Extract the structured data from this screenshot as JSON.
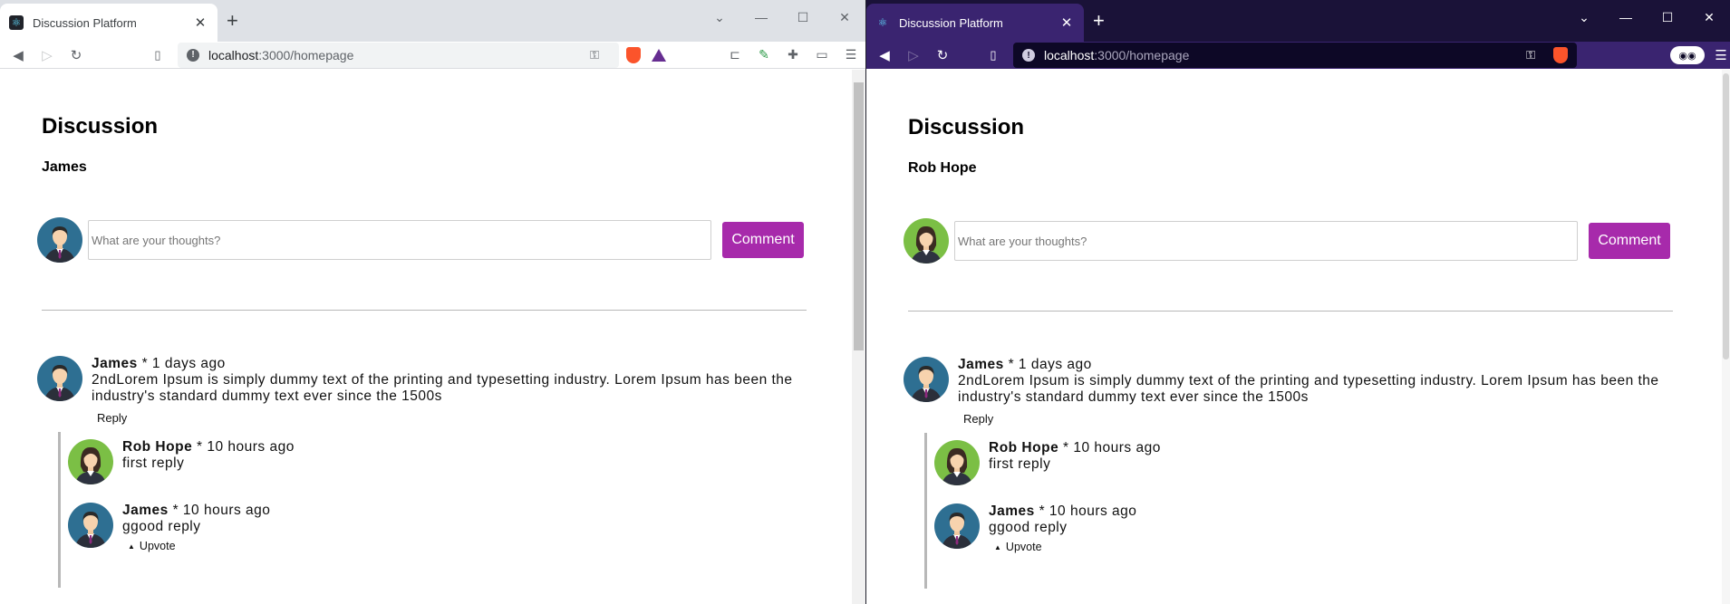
{
  "windows": [
    {
      "tab": {
        "title": "Discussion Platform",
        "favicon_icon": "react-icon",
        "close_glyph": "✕"
      },
      "controls": {
        "new_tab": "+",
        "minimize": "—",
        "maximize": "☐",
        "close": "✕"
      },
      "toolbar": {
        "back": "◀",
        "forward": "▷",
        "reload": "↻",
        "bookmark": "🔖"
      },
      "address": {
        "host": "localhost",
        "rest": ":3000/homepage"
      },
      "page": {
        "heading": "Discussion",
        "username": "James",
        "composer": {
          "avatar": "male-avatar",
          "placeholder": "What are your thoughts?",
          "button": "Comment"
        },
        "thread": {
          "author": "James",
          "time": " * 1 days ago",
          "text": "2ndLorem Ipsum is simply dummy text of the printing and typesetting industry. Lorem Ipsum has been the industry's standard dummy text ever since the 1500s",
          "reply_label": "Reply",
          "replies": [
            {
              "author": "Rob Hope",
              "time": " * 10 hours ago",
              "text": "first reply",
              "avatar": "female-avatar"
            },
            {
              "author": "James",
              "time": " * 10 hours ago",
              "text": "ggood reply",
              "avatar": "male-avatar",
              "upvote_label": "Upvote"
            }
          ]
        }
      }
    },
    {
      "tab": {
        "title": "Discussion Platform",
        "favicon_icon": "react-icon",
        "close_glyph": "✕"
      },
      "controls": {
        "new_tab": "+",
        "minimize": "—",
        "maximize": "☐",
        "close": "✕"
      },
      "toolbar": {
        "back": "◀",
        "forward": "▷",
        "reload": "↻",
        "bookmark": "🔖"
      },
      "address": {
        "host": "localhost",
        "rest": ":3000/homepage"
      },
      "page": {
        "heading": "Discussion",
        "username": "Rob Hope",
        "composer": {
          "avatar": "female-avatar",
          "placeholder": "What are your thoughts?",
          "button": "Comment"
        },
        "thread": {
          "author": "James",
          "time": " * 1 days ago",
          "text": "2ndLorem Ipsum is simply dummy text of the printing and typesetting industry. Lorem Ipsum has been the industry's standard dummy text ever since the 1500s",
          "reply_label": "Reply",
          "replies": [
            {
              "author": "Rob Hope",
              "time": " * 10 hours ago",
              "text": "first reply",
              "avatar": "female-avatar"
            },
            {
              "author": "James",
              "time": " * 10 hours ago",
              "text": "ggood reply",
              "avatar": "male-avatar",
              "upvote_label": "Upvote"
            }
          ]
        }
      }
    }
  ],
  "colors": {
    "accent": "#a72aab",
    "left_chrome": "#dee1e6",
    "right_chrome": "#3a2470",
    "right_tabstrip": "#1a1238",
    "divider": "#b8b8b8",
    "avatar_male_bg": "#2e6f92",
    "avatar_female_bg": "#7bbf45"
  }
}
